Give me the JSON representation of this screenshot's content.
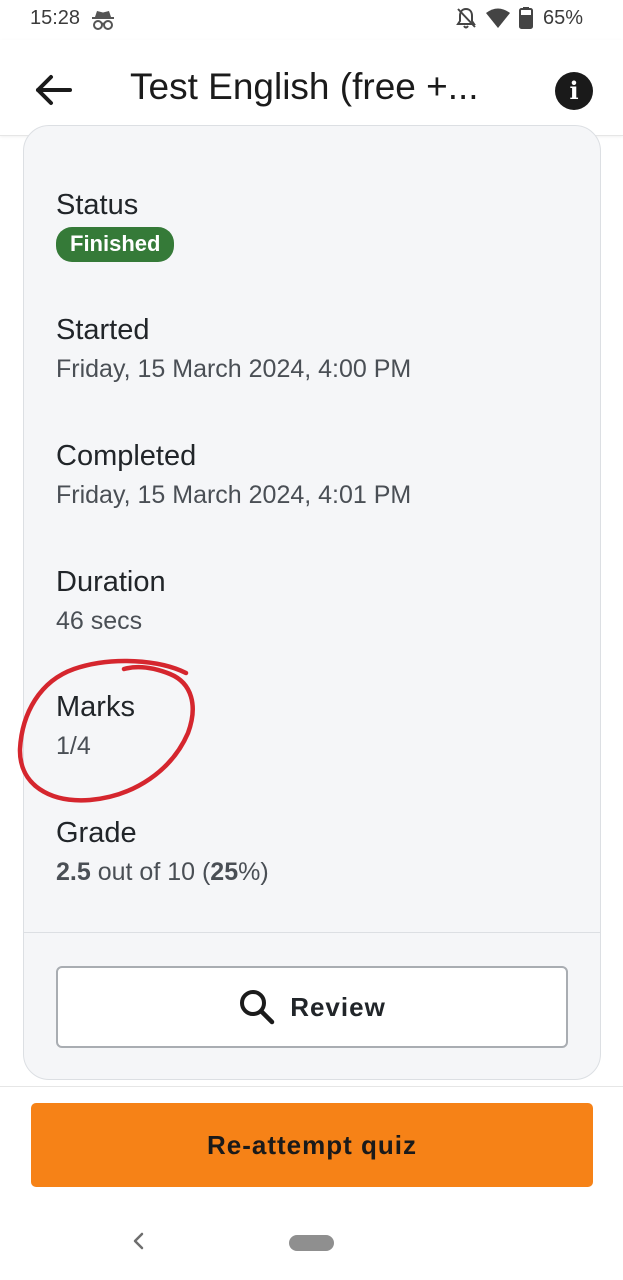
{
  "status_bar": {
    "time": "15:28",
    "battery": "65%",
    "icons": [
      "incognito-icon",
      "notifications-off-icon",
      "wifi-icon",
      "battery-icon"
    ]
  },
  "app_bar": {
    "title": "Test English (free +...",
    "icons": [
      "back-arrow-icon",
      "info-icon"
    ]
  },
  "summary": {
    "status": {
      "label": "Status",
      "value": "Finished",
      "color": "#357a38"
    },
    "started": {
      "label": "Started",
      "value": "Friday, 15 March 2024, 4:00 PM"
    },
    "completed": {
      "label": "Completed",
      "value": "Friday, 15 March 2024, 4:01 PM"
    },
    "duration": {
      "label": "Duration",
      "value": "46 secs"
    },
    "marks": {
      "label": "Marks",
      "value": "1/4"
    },
    "grade": {
      "label": "Grade",
      "score": "2.5",
      "middle": " out of 10 (",
      "percent": "25",
      "end": "%)"
    }
  },
  "review_button": {
    "label": "Review",
    "icon": "search-icon"
  },
  "reattempt_button": {
    "label": "Re-attempt quiz",
    "color": "#f68217"
  },
  "annotation": {
    "color": "#d5262e"
  },
  "system_nav": {
    "icons": [
      "nav-back-icon",
      "nav-home-pill"
    ]
  }
}
